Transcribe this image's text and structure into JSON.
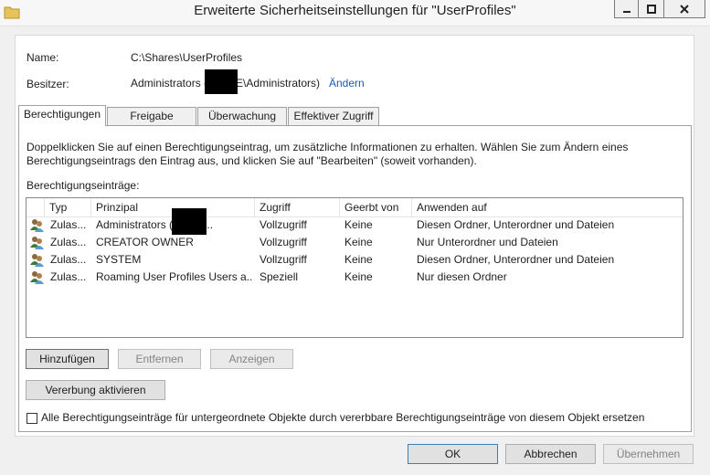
{
  "window": {
    "title": "Erweiterte Sicherheitseinstellungen für \"UserProfiles\""
  },
  "info": {
    "name_label": "Name:",
    "name_value": "C:\\Shares\\UserProfiles",
    "owner_label": "Besitzer:",
    "owner_prefix": "Administrators (",
    "owner_suffix": "E\\Administrators)",
    "change_link": "Ändern"
  },
  "tabs": [
    {
      "label": "Berechtigungen",
      "active": true
    },
    {
      "label": "Freigabe",
      "active": false
    },
    {
      "label": "Überwachung",
      "active": false
    },
    {
      "label": "Effektiver Zugriff",
      "active": false
    }
  ],
  "description": {
    "line1": "Doppelklicken Sie auf einen Berechtigungseintrag, um zusätzliche Informationen zu erhalten. Wählen Sie zum Ändern eines",
    "line2": "Berechtigungseintrags den Eintrag aus, und klicken Sie auf \"Bearbeiten\" (soweit vorhanden)."
  },
  "entries_label": "Berechtigungseinträge:",
  "table": {
    "columns": [
      "Typ",
      "Prinzipal",
      "Zugriff",
      "Geerbt von",
      "Anwenden auf"
    ],
    "rows": [
      {
        "icon": "users-icon",
        "typ": "Zulas...",
        "prinzipal": "Administrators (       \\Admi...",
        "zugriff": "Vollzugriff",
        "geerbt": "Keine",
        "anwenden": "Diesen Ordner, Unterordner und Dateien"
      },
      {
        "icon": "users-icon",
        "typ": "Zulas...",
        "prinzipal": "CREATOR OWNER",
        "zugriff": "Vollzugriff",
        "geerbt": "Keine",
        "anwenden": "Nur Unterordner und Dateien"
      },
      {
        "icon": "users-icon",
        "typ": "Zulas...",
        "prinzipal": "SYSTEM",
        "zugriff": "Vollzugriff",
        "geerbt": "Keine",
        "anwenden": "Diesen Ordner, Unterordner und Dateien"
      },
      {
        "icon": "users-icon",
        "typ": "Zulas...",
        "prinzipal": "Roaming User Profiles Users a...",
        "zugriff": "Speziell",
        "geerbt": "Keine",
        "anwenden": "Nur diesen Ordner"
      }
    ]
  },
  "buttons": {
    "add": "Hinzufügen",
    "remove": "Entfernen",
    "view": "Anzeigen",
    "inheritance": "Vererbung aktivieren",
    "ok": "OK",
    "cancel": "Abbrechen",
    "apply": "Übernehmen"
  },
  "replace_checkbox": {
    "label": "Alle Berechtigungseinträge für untergeordnete Objekte durch vererbbare Berechtigungseinträge von diesem Objekt ersetzen",
    "checked": false
  },
  "colors": {
    "link": "#1a5bb5",
    "accent_border": "#3c7fb1"
  }
}
